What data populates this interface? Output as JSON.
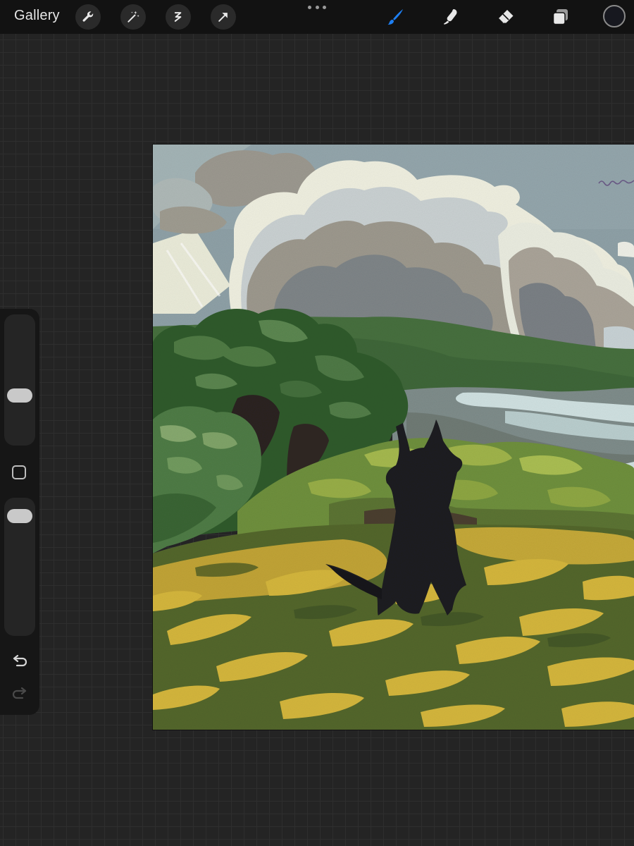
{
  "toolbar": {
    "gallery_label": "Gallery",
    "left_tools": [
      "wrench-icon",
      "magic-wand-icon",
      "selection-icon",
      "transform-arrow-icon"
    ],
    "right_tools": [
      "brush-icon",
      "smudge-icon",
      "eraser-icon",
      "layers-icon"
    ],
    "active_tool": "brush",
    "active_color": "#17181f",
    "accent_color": "#1e7ff2"
  },
  "sidebar": {
    "brush_size": 0.36,
    "opacity": 0.93,
    "undo_enabled": true,
    "redo_enabled": false
  }
}
